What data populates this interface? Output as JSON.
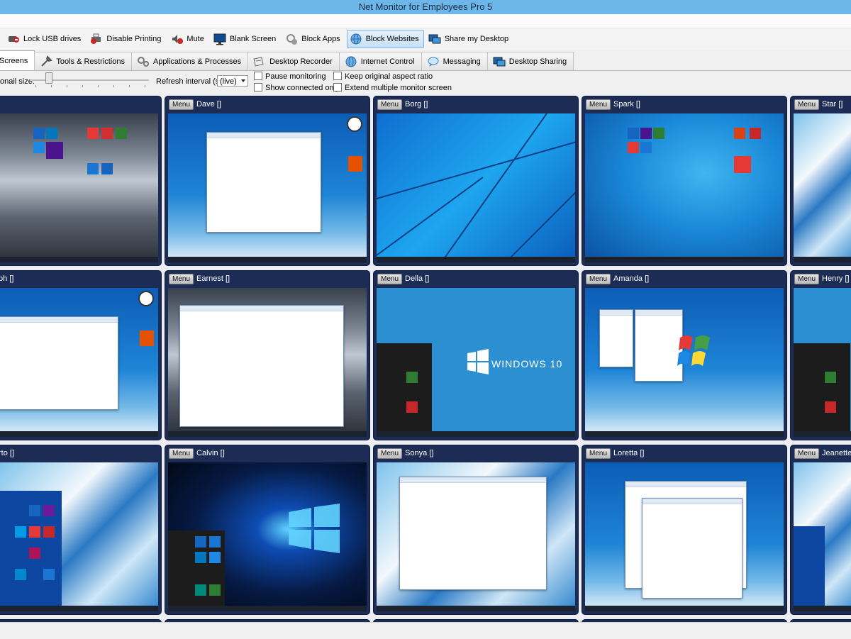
{
  "window": {
    "title": "Net Monitor for Employees Pro 5"
  },
  "toolbar": [
    {
      "label": "Lock USB drives",
      "icon": "usb-lock-icon"
    },
    {
      "label": "Disable Printing",
      "icon": "printer-disabled-icon"
    },
    {
      "label": "Mute",
      "icon": "mute-icon"
    },
    {
      "label": "Blank Screen",
      "icon": "monitor-icon"
    },
    {
      "label": "Block Apps",
      "icon": "block-apps-icon"
    },
    {
      "label": "Block Websites",
      "icon": "globe-icon"
    },
    {
      "label": "Share my Desktop",
      "icon": "share-desktop-icon"
    }
  ],
  "tabs": [
    {
      "label": "Screens",
      "icon": "screens-icon"
    },
    {
      "label": "Tools & Restrictions",
      "icon": "tools-icon"
    },
    {
      "label": "Applications & Processes",
      "icon": "gears-icon"
    },
    {
      "label": "Desktop Recorder",
      "icon": "recorder-icon"
    },
    {
      "label": "Internet Control",
      "icon": "globe-icon"
    },
    {
      "label": "Messaging",
      "icon": "chat-icon"
    },
    {
      "label": "Desktop Sharing",
      "icon": "desktop-share-icon"
    }
  ],
  "options": {
    "thumbnail_size_label": "onail size:",
    "refresh_label": "Refresh interval (s):",
    "refresh_value": "(live)",
    "pause_monitoring": "Pause monitoring",
    "show_connected_only": "Show connected only",
    "keep_aspect_ratio": "Keep original aspect ratio",
    "extend_multiple_monitor": "Extend multiple monitor screen"
  },
  "menu_label": "Menu",
  "computers": [
    {
      "name": "",
      "bracket": "",
      "bg": "bg-mountain"
    },
    {
      "name": "Dave",
      "bracket": "[]",
      "bg": "bg-win7"
    },
    {
      "name": "Borg",
      "bracket": "[]",
      "bg": "bg-win10"
    },
    {
      "name": "Spark",
      "bracket": "[]",
      "bg": "bg-blue"
    },
    {
      "name": "Star",
      "bracket": "[]",
      "bg": "bg-swirl"
    },
    {
      "name": "",
      "bracket": "ph []",
      "bg": "bg-win7"
    },
    {
      "name": "Earnest",
      "bracket": "[]",
      "bg": "bg-mountain"
    },
    {
      "name": "Della",
      "bracket": "[]",
      "bg": "bg-flat",
      "wallpaper_text": "WINDOWS 10"
    },
    {
      "name": "Amanda",
      "bracket": "[]",
      "bg": "bg-win7"
    },
    {
      "name": "Henry",
      "bracket": "[]",
      "bg": "bg-flat"
    },
    {
      "name": "",
      "bracket": "rto []",
      "bg": "bg-swirl"
    },
    {
      "name": "Calvin",
      "bracket": "[]",
      "bg": "bg-dark10"
    },
    {
      "name": "Sonya",
      "bracket": "[]",
      "bg": "bg-swirl"
    },
    {
      "name": "Loretta",
      "bracket": "[]",
      "bg": "bg-win7"
    },
    {
      "name": "Jeanette",
      "bracket": "[]",
      "bg": "bg-swirl"
    }
  ]
}
